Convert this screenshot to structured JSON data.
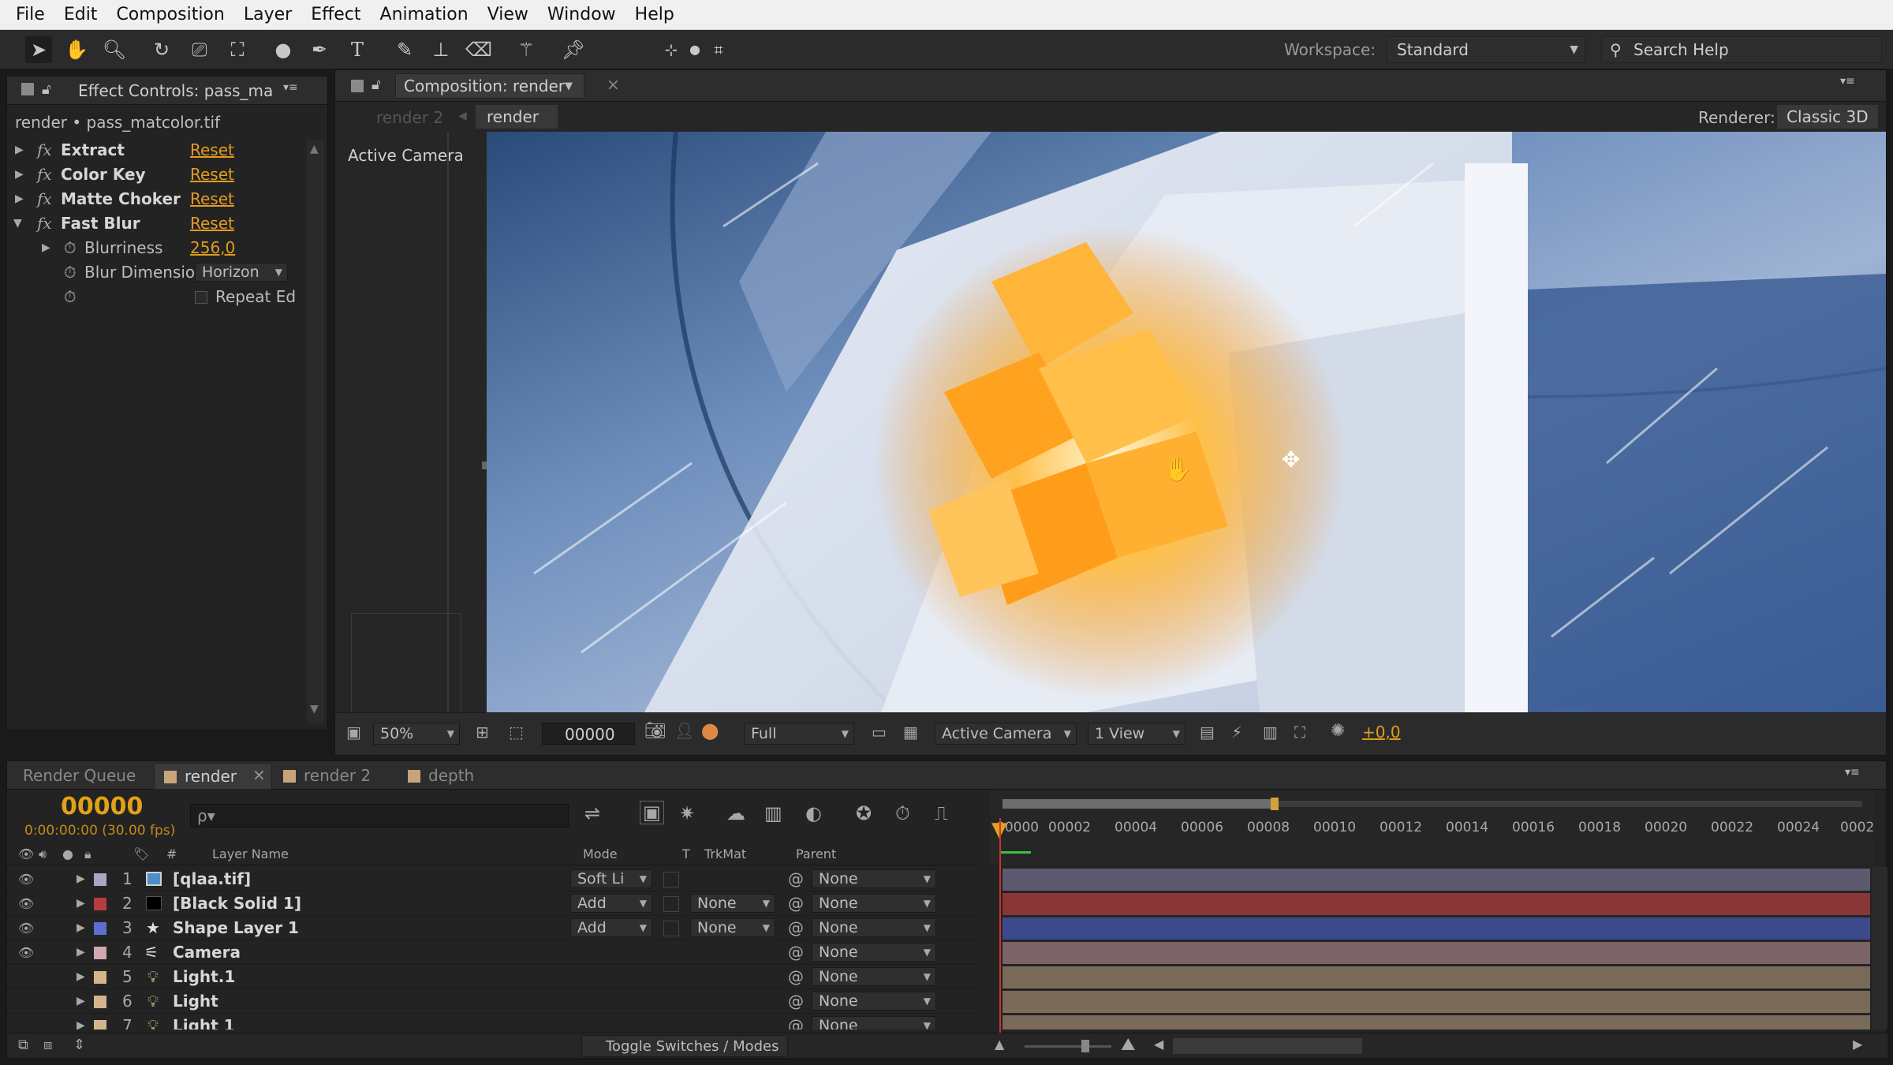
{
  "menu": [
    "File",
    "Edit",
    "Composition",
    "Layer",
    "Effect",
    "Animation",
    "View",
    "Window",
    "Help"
  ],
  "toolbar": {
    "workspace_label": "Workspace:",
    "workspace_value": "Standard",
    "search_placeholder": "Search Help"
  },
  "effect_controls": {
    "tab_title": "Effect Controls: pass_ma",
    "breadcrumb": "render • pass_matcolor.tif",
    "effects": [
      {
        "name": "Extract",
        "reset": "Reset"
      },
      {
        "name": "Color Key",
        "reset": "Reset"
      },
      {
        "name": "Matte Choker",
        "reset": "Reset"
      },
      {
        "name": "Fast Blur",
        "reset": "Reset"
      }
    ],
    "blurriness_label": "Blurriness",
    "blurriness_value": "256,0",
    "blur_dimension_label": "Blur Dimensio",
    "blur_dimension_value": "Horizon",
    "repeat_edge_label": "Repeat Ed"
  },
  "composition": {
    "tab_title": "Composition: render",
    "breadcrumb_inactive": "render 2",
    "breadcrumb_active": "render",
    "renderer_label": "Renderer:",
    "renderer_value": "Classic 3D",
    "view_label": "Active Camera",
    "footer": {
      "zoom": "50%",
      "timecode": "00000",
      "resolution": "Full",
      "camera": "Active Camera",
      "views": "1 View",
      "exposure": "+0,0"
    }
  },
  "timeline": {
    "tabs": [
      "Render Queue",
      "render",
      "render 2",
      "depth"
    ],
    "current_time": "00000",
    "time_sub": "0:00:00:00 (30.00 fps)",
    "search_placeholder": "ρ▾",
    "columns": {
      "num": "#",
      "layer_name": "Layer Name",
      "mode": "Mode",
      "t": "T",
      "trkmat": "TrkMat",
      "parent": "Parent"
    },
    "ruler": [
      "00000",
      "00002",
      "00004",
      "00006",
      "00008",
      "00010",
      "00012",
      "00014",
      "00016",
      "00018",
      "00020",
      "00022",
      "00024",
      "0002"
    ],
    "layers": [
      {
        "num": "1",
        "name": "[qlaa.tif]",
        "mode": "Soft Li",
        "trkmat": "",
        "parent": "None",
        "label_color": "#a6a6c8",
        "bar_color": "#5c5a6e",
        "icon": "image-icon"
      },
      {
        "num": "2",
        "name": "[Black Solid 1]",
        "mode": "Add",
        "trkmat": "None",
        "parent": "None",
        "label_color": "#b83c3c",
        "bar_color": "#8a3636",
        "icon": "solid-icon"
      },
      {
        "num": "3",
        "name": "Shape Layer 1",
        "mode": "Add",
        "trkmat": "None",
        "parent": "None",
        "label_color": "#5a6fd0",
        "bar_color": "#3c4a8c",
        "icon": "star-icon"
      },
      {
        "num": "4",
        "name": "Camera",
        "mode": "",
        "trkmat": "",
        "parent": "None",
        "label_color": "#d0a8b0",
        "bar_color": "#7a6468",
        "icon": "camera-icon"
      },
      {
        "num": "5",
        "name": "Light.1",
        "mode": "",
        "trkmat": "",
        "parent": "None",
        "label_color": "#d4b48c",
        "bar_color": "#7a6a58",
        "icon": "light-icon"
      },
      {
        "num": "6",
        "name": "Light",
        "mode": "",
        "trkmat": "",
        "parent": "None",
        "label_color": "#d4b48c",
        "bar_color": "#7a6a58",
        "icon": "light-icon"
      },
      {
        "num": "7",
        "name": "Light 1",
        "mode": "",
        "trkmat": "",
        "parent": "None",
        "label_color": "#d4b48c",
        "bar_color": "#7a6a58",
        "icon": "light-icon"
      }
    ],
    "toggle_label": "Toggle Switches / Modes"
  }
}
